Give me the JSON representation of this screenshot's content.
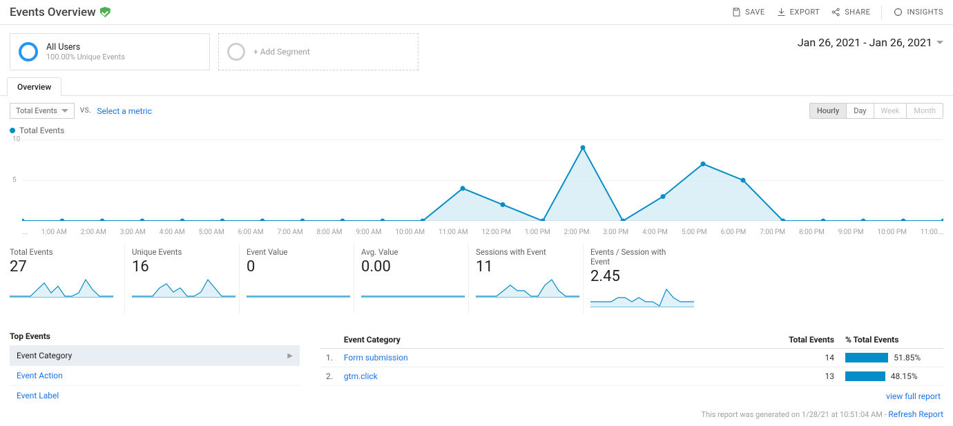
{
  "header": {
    "title": "Events Overview",
    "actions": {
      "save": "SAVE",
      "export": "EXPORT",
      "share": "SHARE",
      "insights": "INSIGHTS"
    }
  },
  "segments": {
    "primary": {
      "title": "All Users",
      "subtitle": "100.00% Unique Events"
    },
    "add_label": "+ Add Segment"
  },
  "date_range": "Jan 26, 2021 - Jan 26, 2021",
  "tab": "Overview",
  "controls": {
    "metric_dropdown": "Total Events",
    "vs": "VS.",
    "select_metric": "Select a metric",
    "granularity": {
      "hourly": "Hourly",
      "day": "Day",
      "week": "Week",
      "month": "Month"
    }
  },
  "legend": "Total Events",
  "chart_data": {
    "type": "line",
    "title": "",
    "xlabel": "",
    "ylabel": "",
    "ylim": [
      0,
      10
    ],
    "yticks": [
      5,
      10
    ],
    "categories": [
      "...",
      "1:00 AM",
      "2:00 AM",
      "3:00 AM",
      "4:00 AM",
      "5:00 AM",
      "6:00 AM",
      "7:00 AM",
      "8:00 AM",
      "9:00 AM",
      "10:00 AM",
      "11:00 AM",
      "12:00 PM",
      "1:00 PM",
      "2:00 PM",
      "3:00 PM",
      "4:00 PM",
      "5:00 PM",
      "6:00 PM",
      "7:00 PM",
      "8:00 PM",
      "9:00 PM",
      "10:00 PM",
      "11:00..."
    ],
    "series": [
      {
        "name": "Total Events",
        "color": "#058dc7",
        "values": [
          0,
          0,
          0,
          0,
          0,
          0,
          0,
          0,
          0,
          0,
          0,
          4,
          2,
          0,
          9,
          0,
          3,
          7,
          5,
          0,
          0,
          0,
          0,
          0
        ]
      }
    ]
  },
  "metrics": [
    {
      "label": "Total Events",
      "value": "27",
      "spark": [
        0,
        0,
        0,
        0,
        2,
        4,
        1,
        3,
        0,
        0,
        1,
        5,
        2,
        0,
        0,
        0
      ]
    },
    {
      "label": "Unique Events",
      "value": "16",
      "spark": [
        0,
        0,
        0,
        0,
        2,
        3,
        1,
        2,
        0,
        0,
        1,
        4,
        2,
        0,
        0,
        0
      ]
    },
    {
      "label": "Event Value",
      "value": "0",
      "spark": [
        0,
        0,
        0,
        0,
        0,
        0,
        0,
        0,
        0,
        0,
        0,
        0,
        0,
        0,
        0,
        0
      ]
    },
    {
      "label": "Avg. Value",
      "value": "0.00",
      "spark": [
        0,
        0,
        0,
        0,
        0,
        0,
        0,
        0,
        0,
        0,
        0,
        0,
        0,
        0,
        0,
        0
      ]
    },
    {
      "label": "Sessions with Event",
      "value": "11",
      "spark": [
        0,
        0,
        0,
        0,
        1,
        2,
        1,
        1,
        0,
        0,
        2,
        3,
        1,
        0,
        0,
        0
      ]
    },
    {
      "label": "Events / Session with Event",
      "value": "2.45",
      "spark": [
        1,
        1,
        1,
        1,
        2,
        2,
        1,
        2,
        1,
        1,
        0,
        4,
        2,
        1,
        1,
        1
      ]
    }
  ],
  "top_events": {
    "heading": "Top Events",
    "rows": [
      {
        "label": "Event Category",
        "active": true
      },
      {
        "label": "Event Action",
        "active": false
      },
      {
        "label": "Event Label",
        "active": false
      }
    ]
  },
  "event_table": {
    "headers": {
      "category": "Event Category",
      "total": "Total Events",
      "pct": "% Total Events"
    },
    "rows": [
      {
        "idx": "1.",
        "name": "Form submission",
        "total": "14",
        "pct": "51.85%",
        "barpct": 51.85
      },
      {
        "idx": "2.",
        "name": "gtm.click",
        "total": "13",
        "pct": "48.15%",
        "barpct": 48.15
      }
    ],
    "view_full": "view full report"
  },
  "footnote": {
    "text": "This report was generated on 1/28/21 at 10:51:04 AM - ",
    "link": "Refresh Report"
  }
}
